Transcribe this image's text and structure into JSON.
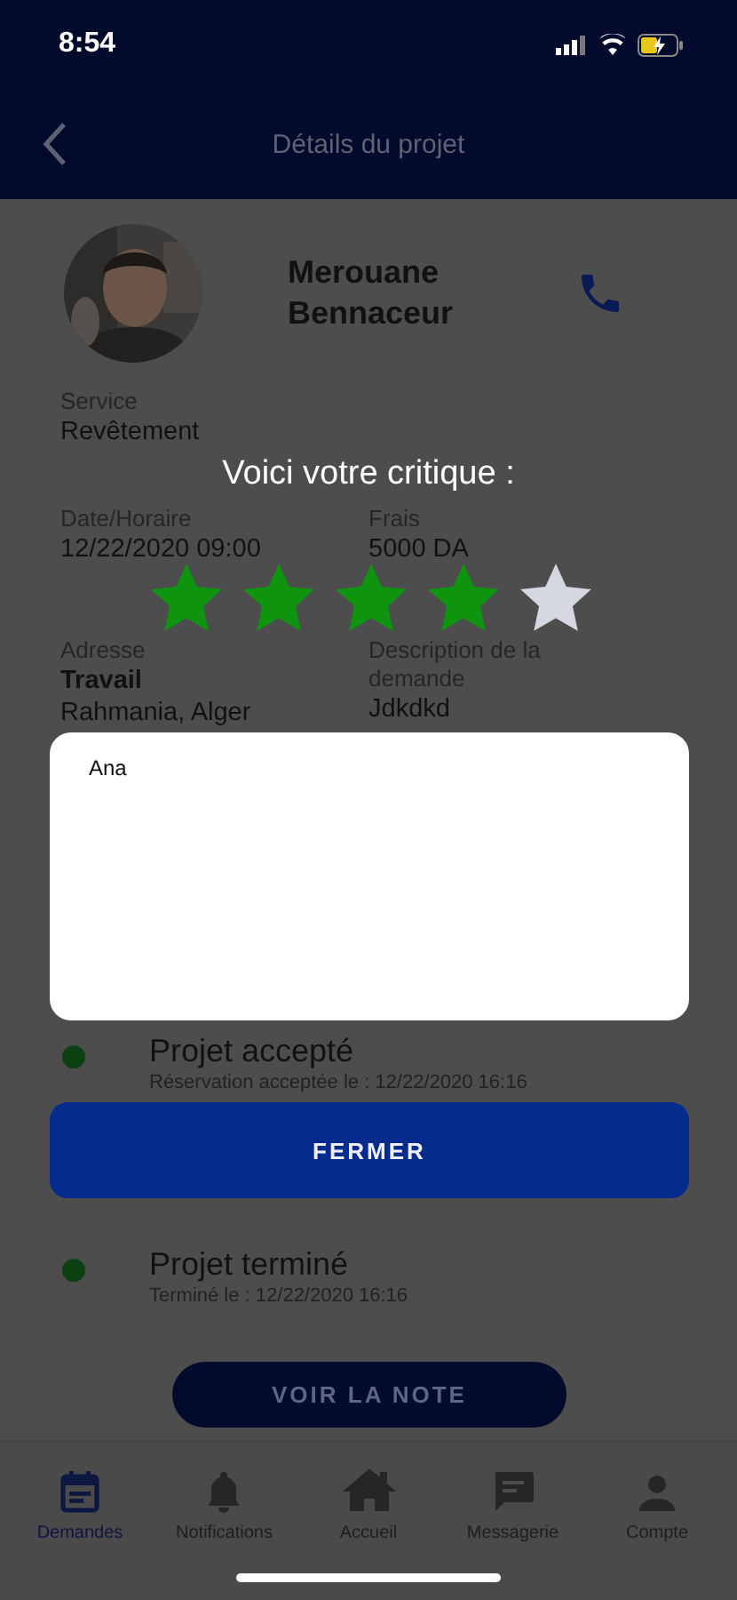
{
  "status_bar": {
    "time": "8:54"
  },
  "header": {
    "title": "Détails du projet"
  },
  "profile": {
    "name": "Merouane Bennaceur"
  },
  "details": [
    [
      {
        "label": "Service",
        "value": "Revêtement"
      }
    ],
    [
      {
        "label": "Date/Horaire",
        "value": "12/22/2020 09:00"
      },
      {
        "label": "Frais",
        "value": "5000 DA"
      }
    ],
    [
      {
        "label": "Adresse",
        "title": "Travail",
        "value": "Rahmania, Alger"
      },
      {
        "label": "Description de la demande",
        "value": "Jdkdkd"
      }
    ]
  ],
  "timeline": [
    {
      "title": "Projet accepté",
      "subtitle": "Réservation acceptée le : 12/22/2020 16:16",
      "done": true
    },
    {
      "title": "Projet terminé",
      "subtitle": "Terminé le : 12/22/2020 16:16",
      "done": true
    }
  ],
  "note_button": "VOIR LA NOTE",
  "tabs": [
    {
      "label": "Demandes",
      "selected": true
    },
    {
      "label": "Notifications",
      "selected": false
    },
    {
      "label": "Accueil",
      "selected": false
    },
    {
      "label": "Messagerie",
      "selected": false
    },
    {
      "label": "Compte",
      "selected": false
    }
  ],
  "rating_dialog": {
    "title": "Voici votre critique :",
    "stars": 4,
    "comment": "Ana",
    "button": "FERMER"
  }
}
